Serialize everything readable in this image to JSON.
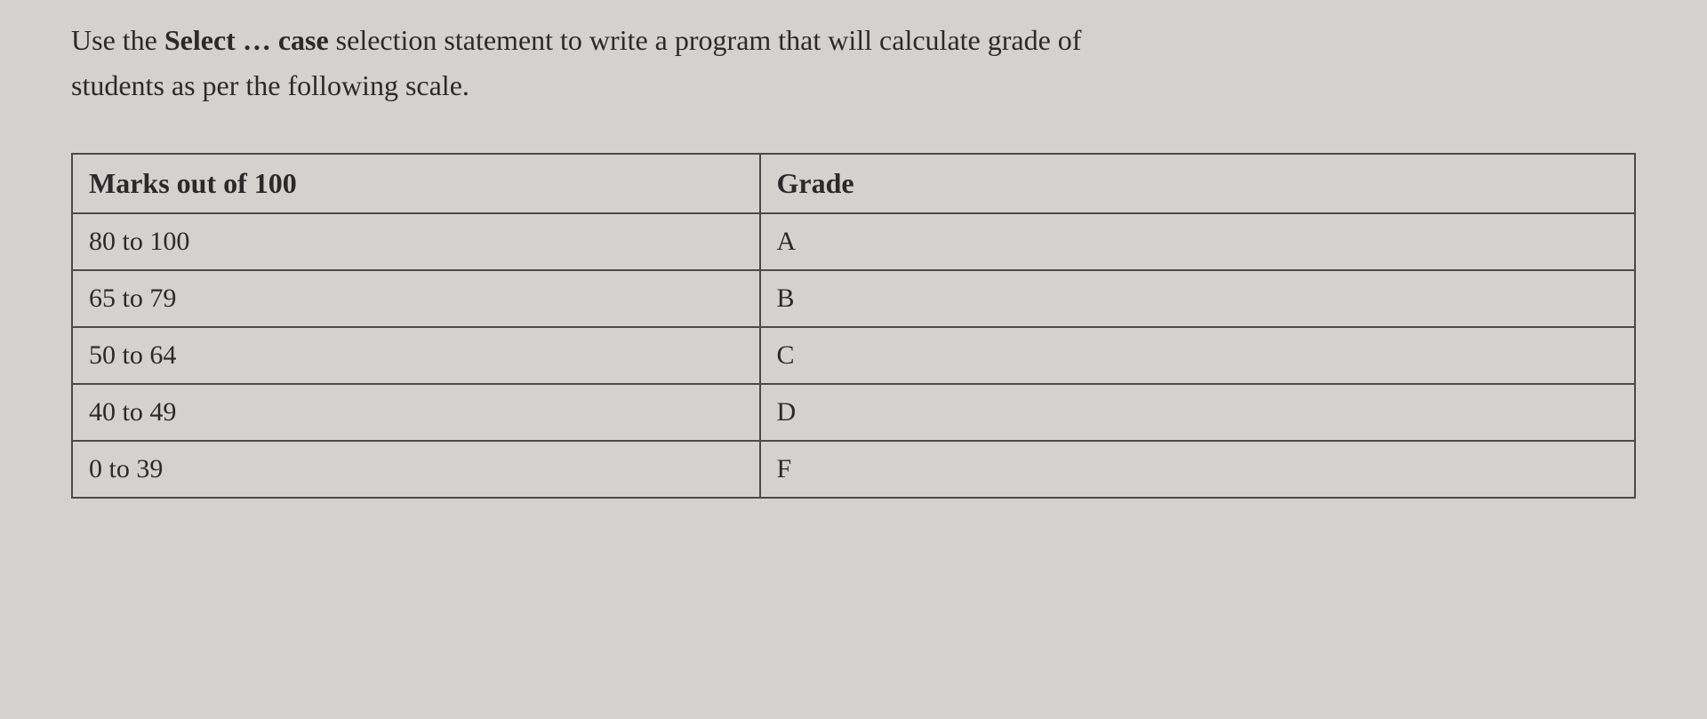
{
  "instruction": {
    "prefix": "Use the ",
    "bold1": "Select … case",
    "middle": " selection statement to write a program that will calculate grade of students as per the following scale."
  },
  "table": {
    "headers": {
      "marks": "Marks out of 100",
      "grade": "Grade"
    },
    "rows": [
      {
        "marks": "80 to 100",
        "grade": "A"
      },
      {
        "marks": "65 to 79",
        "grade": "B"
      },
      {
        "marks": "50  to 64",
        "grade": "C"
      },
      {
        "marks": "40 to 49",
        "grade": "D"
      },
      {
        "marks": "0 to 39",
        "grade": "F"
      }
    ]
  },
  "chart_data": {
    "type": "table",
    "title": "Grade Scale",
    "columns": [
      "Marks out of 100",
      "Grade"
    ],
    "rows": [
      [
        "80 to 100",
        "A"
      ],
      [
        "65 to 79",
        "B"
      ],
      [
        "50 to 64",
        "C"
      ],
      [
        "40 to 49",
        "D"
      ],
      [
        "0 to 39",
        "F"
      ]
    ]
  }
}
